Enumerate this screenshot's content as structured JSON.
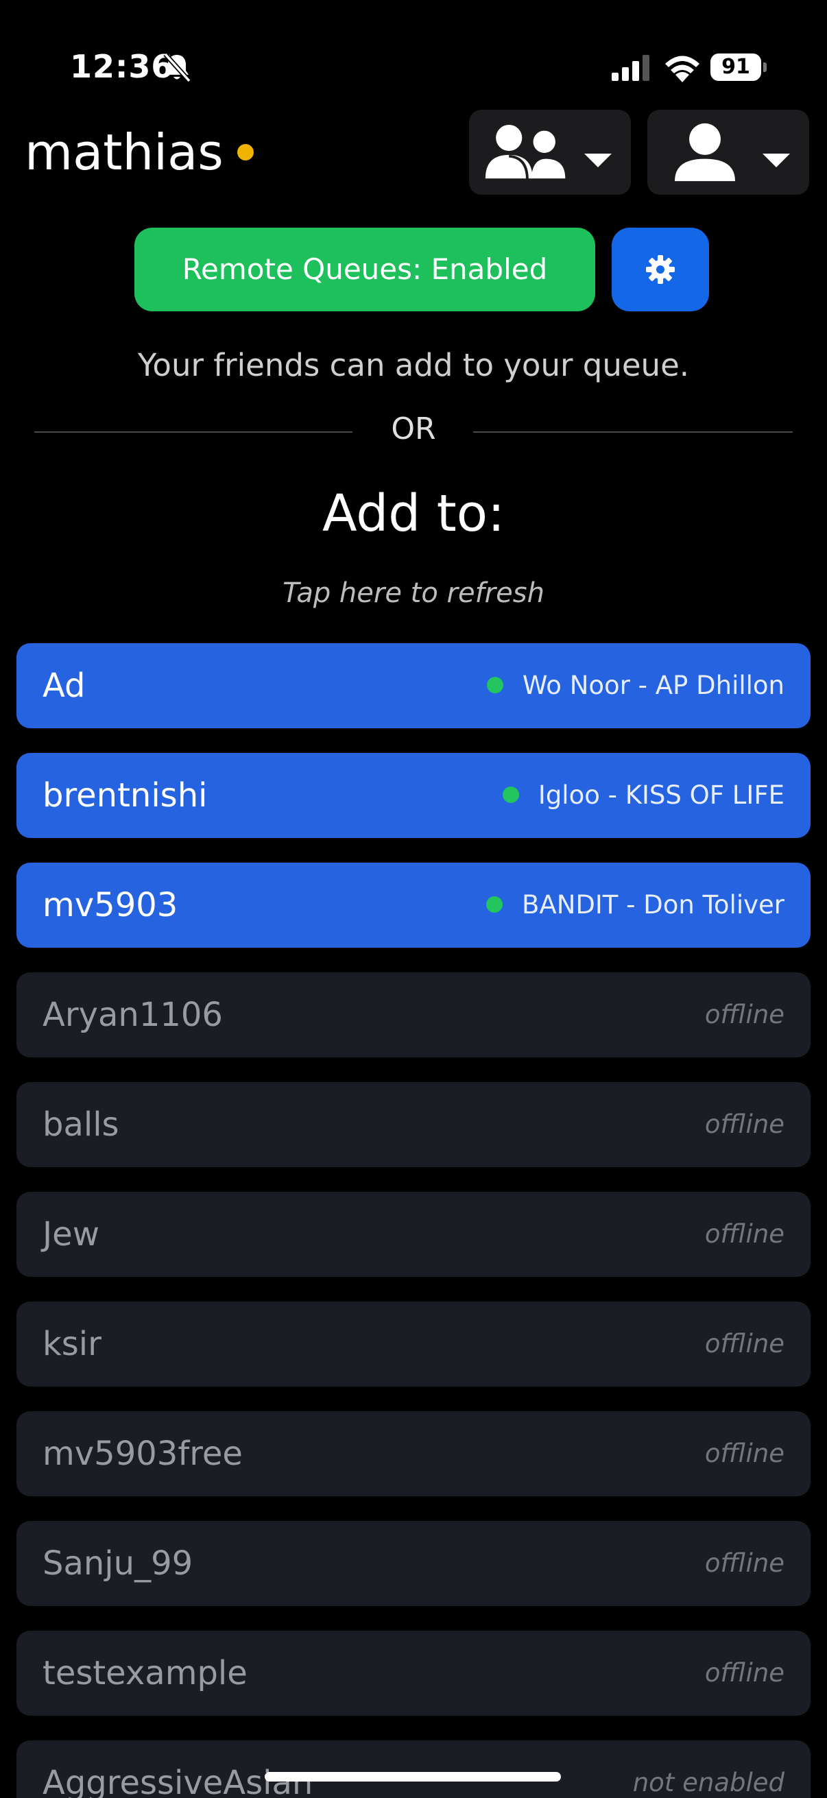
{
  "status_bar": {
    "time": "12:36",
    "battery": "91",
    "icons": [
      "bell-slash-icon",
      "cellular-signal-icon",
      "wifi-icon",
      "battery-icon"
    ]
  },
  "header": {
    "username": "mathias",
    "presence_color": "#f0b400",
    "friends_button_icon": "users-icon",
    "profile_button_icon": "user-icon"
  },
  "remote_queue": {
    "button_label": "Remote Queues: Enabled",
    "button_color": "#1ec05c",
    "settings_icon": "gear-icon",
    "settings_color": "#1467e6",
    "info_text": "Your friends can add to your queue."
  },
  "divider": {
    "label": "OR"
  },
  "add_to": {
    "title": "Add to:",
    "refresh_hint": "Tap here to refresh"
  },
  "friends": [
    {
      "name": "Ad",
      "status": "Wo Noor - AP Dhillon",
      "state": "online"
    },
    {
      "name": "brentnishi",
      "status": "Igloo - KISS OF LIFE",
      "state": "online"
    },
    {
      "name": "mv5903",
      "status": "BANDIT - Don Toliver",
      "state": "online"
    },
    {
      "name": "Aryan1106",
      "status": "offline",
      "state": "offline"
    },
    {
      "name": "balls",
      "status": "offline",
      "state": "offline"
    },
    {
      "name": "Jew",
      "status": "offline",
      "state": "offline"
    },
    {
      "name": "ksir",
      "status": "offline",
      "state": "offline"
    },
    {
      "name": "mv5903free",
      "status": "offline",
      "state": "offline"
    },
    {
      "name": "Sanju_99",
      "status": "offline",
      "state": "offline"
    },
    {
      "name": "testexample",
      "status": "offline",
      "state": "offline"
    },
    {
      "name": "AggressiveAsian",
      "status": "not enabled",
      "state": "disabled"
    }
  ],
  "colors": {
    "online_row": "#2563e0",
    "offline_row": "#1b1d24",
    "listening_dot": "#22c55e"
  }
}
